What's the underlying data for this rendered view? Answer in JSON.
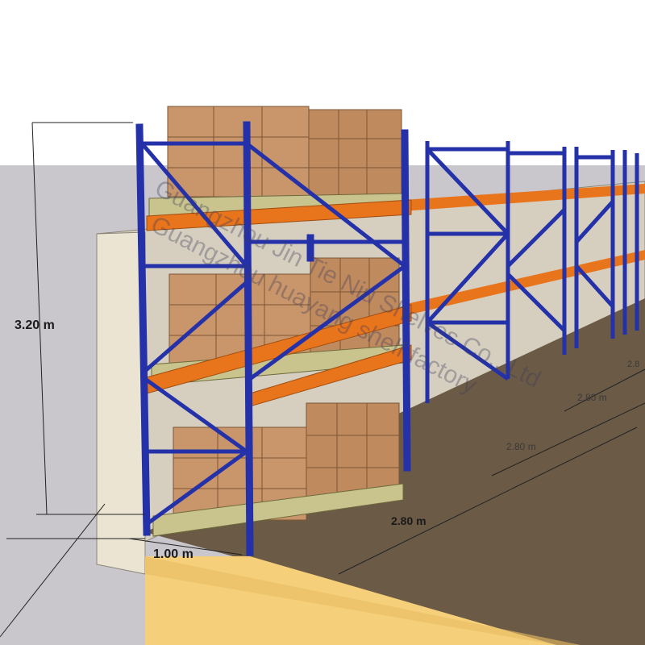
{
  "dimensions": {
    "height": "3.20 m",
    "depth": "1.00 m",
    "bay_width": "2.80 m",
    "bay_width_2": "2.80 m",
    "bay_width_3": "2.80 m",
    "bay_width_4": "2.8"
  },
  "watermark": {
    "line1": "Guangzhou Jin Tie Niu Shelves Co., Ltd",
    "line2": "Guangzhou huayang shelf factory"
  },
  "colors": {
    "upright": "#2431a8",
    "beam": "#e8741c",
    "carton": "#c9956a",
    "pallet": "#c9c48e",
    "floor": "#6b5a45",
    "wall": "#d9d2c4",
    "sky": "#c9c7cc",
    "curb": "#f5cf7a"
  }
}
